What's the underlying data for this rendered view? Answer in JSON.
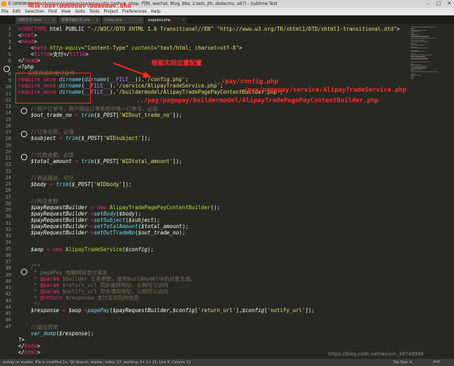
{
  "window": {
    "title": "E:\\WWW\\item\\jxshop\\pay\\pagepay\\pagepay.php (jxshop, shop, 代码, wechat, Blog, bbs, 2.test, jth, dedecms, a67) - Sublime Text",
    "minimize": "–",
    "maximize": "□",
    "close": "✕"
  },
  "menu": [
    "File",
    "Edit",
    "Selection",
    "Find",
    "View",
    "Goto",
    "Tools",
    "Project",
    "Preferences",
    "Help"
  ],
  "tabs": [
    {
      "label": "扫码支付.html",
      "active": false
    },
    {
      "label": "登录页面分享.php",
      "active": false
    },
    {
      "label": "index.php",
      "active": false
    },
    {
      "label": "pagepay.php",
      "active": true
    }
  ],
  "code_lines": [
    {
      "n": "1"
    },
    {
      "n": "2"
    },
    {
      "n": "3"
    },
    {
      "n": "4"
    },
    {
      "n": "5"
    },
    {
      "n": "6"
    },
    {
      "n": "7"
    },
    {
      "n": "8"
    },
    {
      "n": "9"
    },
    {
      "n": "10"
    },
    {
      "n": "11"
    },
    {
      "n": "12"
    },
    {
      "n": "13"
    },
    {
      "n": "14"
    },
    {
      "n": "15"
    },
    {
      "n": "16"
    },
    {
      "n": "17"
    },
    {
      "n": "18"
    },
    {
      "n": "19"
    },
    {
      "n": "20"
    },
    {
      "n": "21"
    },
    {
      "n": "22"
    },
    {
      "n": "23"
    },
    {
      "n": "24"
    },
    {
      "n": "25"
    },
    {
      "n": "26"
    },
    {
      "n": "27"
    },
    {
      "n": "28"
    },
    {
      "n": "29"
    },
    {
      "n": "30"
    },
    {
      "n": "31"
    },
    {
      "n": "32"
    },
    {
      "n": "33"
    },
    {
      "n": "34"
    },
    {
      "n": "35"
    },
    {
      "n": "36"
    },
    {
      "n": "37"
    },
    {
      "n": "38"
    },
    {
      "n": "39"
    },
    {
      "n": "40"
    },
    {
      "n": "41"
    },
    {
      "n": "42"
    },
    {
      "n": "43"
    },
    {
      "n": "44"
    },
    {
      "n": "45"
    },
    {
      "n": "46"
    },
    {
      "n": "47"
    }
  ],
  "code": {
    "l1": {
      "a": "<!DOCTYPE",
      "b": " html PUBLIC ",
      "c": "\"-//W3C//DTD XHTML 1.0 Transitional//EN\"",
      "d": " ",
      "e": "\"http://www.w3.org/TR/xhtml1/DTD/xhtml1-transitional.dtd\"",
      "f": ">"
    },
    "l2": {
      "a": "<",
      "b": "html",
      "c": ">"
    },
    "l3": {
      "a": "<",
      "b": "head",
      "c": ">"
    },
    "l4": {
      "a": "    <",
      "b": "meta",
      "c": " http-equiv",
      "d": "=",
      "e": "\"Content-Type\"",
      "f": " content",
      "g": "=",
      "h": "\"text/html; charset=utf-8\"",
      "i": ">"
    },
    "l5": {
      "a": "    <",
      "b": "title",
      "c": ">支付</",
      "d": "title",
      "e": ">"
    },
    "l6": {
      "a": "</",
      "b": "head",
      "c": ">"
    },
    "l7": {
      "a": "<?php"
    },
    "l8": {
      "a": "// 实现具体的支付操作"
    },
    "l9": {
      "a": "require_once",
      "b": " ",
      "c": "dirname",
      "d": "(",
      "e": "dirname",
      "f": "(",
      "g": "__FILE__",
      "h": ")).",
      "i": "'/config.php'",
      "j": ";"
    },
    "l10": {
      "a": "require_once",
      "b": " ",
      "c": "dirname",
      "d": "(",
      "e": "__FILE__",
      "f": ").",
      "g": "'/service/AlipayTradeService.php'",
      "h": ";"
    },
    "l11": {
      "a": "require_once",
      "b": " ",
      "c": "dirname",
      "d": "(",
      "e": "__FILE__",
      "f": ").",
      "g": "'/buildermodel/AlipayTradePagePayContentBuilder.php'",
      "h": ";"
    },
    "l13": {
      "a": "    //商户订单号，商户网站订单系统中唯一订单号，必填"
    },
    "l14": {
      "a": "    ",
      "b": "$out_trade_no",
      "c": " = ",
      "d": "trim",
      "e": "(",
      "f": "$_POST",
      "g": "[",
      "h": "'WIDout_trade_no'",
      "i": "]);"
    },
    "l16": {
      "a": "    //订单名称，必填"
    },
    "l17": {
      "a": "    ",
      "b": "$subject",
      "c": " = ",
      "d": "trim",
      "e": "(",
      "f": "$_POST",
      "g": "[",
      "h": "'WIDsubject'",
      "i": "]);"
    },
    "l19": {
      "a": "    //付款金额，必填"
    },
    "l20": {
      "a": "    ",
      "b": "$total_amount",
      "c": " = ",
      "d": "trim",
      "e": "(",
      "f": "$_POST",
      "g": "[",
      "h": "'WIDtotal_amount'",
      "i": "]);"
    },
    "l22": {
      "a": "    //商品描述，可空"
    },
    "l23": {
      "a": "    ",
      "b": "$body",
      "c": " = ",
      "d": "trim",
      "e": "(",
      "f": "$_POST",
      "g": "[",
      "h": "'WIDbody'",
      "i": "]);"
    },
    "l25": {
      "a": "    //构造参数"
    },
    "l26": {
      "a": "    ",
      "b": "$payRequestBuilder",
      "c": " = ",
      "d": "new",
      "e": " ",
      "f": "AlipayTradePagePayContentBuilder",
      "g": "();"
    },
    "l27": {
      "a": "    ",
      "b": "$payRequestBuilder",
      "c": "->",
      "d": "setBody",
      "e": "(",
      "f": "$body",
      "g": ");"
    },
    "l28": {
      "a": "    ",
      "b": "$payRequestBuilder",
      "c": "->",
      "d": "setSubject",
      "e": "(",
      "f": "$subject",
      "g": ");"
    },
    "l29": {
      "a": "    ",
      "b": "$payRequestBuilder",
      "c": "->",
      "d": "setTotalAmount",
      "e": "(",
      "f": "$total_amount",
      "g": ");"
    },
    "l30": {
      "a": "    ",
      "b": "$payRequestBuilder",
      "c": "->",
      "d": "setOutTradeNo",
      "e": "(",
      "f": "$out_trade_no",
      "g": ");"
    },
    "l32": {
      "a": "    ",
      "b": "$aop",
      "c": " = ",
      "d": "new",
      "e": " ",
      "f": "AlipayTradeService",
      "g": "(",
      "h": "$config",
      "i": ");"
    },
    "l34": {
      "a": "    /**"
    },
    "l35": {
      "a": "     * pagePay 电脑网站支付请求"
    },
    "l36": {
      "a": "     * ",
      "b": "@param",
      "c": " $builder 业务参数，使用buildmodel中的对象生成。"
    },
    "l37": {
      "a": "     * ",
      "b": "@param",
      "c": " $return_url 同步跳转地址，公网可以访问"
    },
    "l38": {
      "a": "     * ",
      "b": "@param",
      "c": " $notify_url 异步通知地址，公网可以访问"
    },
    "l39": {
      "a": "     * ",
      "b": "@return",
      "c": " $response 支付宝返回的信息"
    },
    "l40": {
      "a": "     */"
    },
    "l41": {
      "a": "    ",
      "b": "$response",
      "c": " = ",
      "d": "$aop",
      "e": "->",
      "f": "pagePay",
      "g": "(",
      "h": "$payRequestBuilder",
      "i": ",",
      "j": "$config",
      "k": "[",
      "l": "'return_url'",
      "m": "],",
      "n": "$config",
      "o": "[",
      "p": "'notify_url'",
      "q": "]);"
    },
    "l43": {
      "a": "    //输出表单"
    },
    "l44": {
      "a": "    ",
      "b": "var_dump",
      "c": "(",
      "d": "$response",
      "e": ");"
    },
    "l45": {
      "a": "?>"
    },
    "l46": {
      "a": "</",
      "b": "body",
      "c": ">"
    },
    "l47": {
      "a": "</",
      "b": "html",
      "c": ">"
    }
  },
  "annotations": {
    "title_path": "项目\\pay\\pagepay\\pagepay.php",
    "actual_location": "根据实际位置配置",
    "path_config": "../pay/config.php",
    "path_service": "../pay/pagepay/service/AlipayTradeService.php",
    "path_builder": "../pay/pagepay/buildermodel/AlipayTradePagePayContentBuilder.php"
  },
  "watermark": "https://blog.csdn.net/weixin_39749988",
  "status": {
    "left": "jxshop on master, File is modified 1+, Git branch: master, index: 27, working: 3+ 1+ 21; Line 8, Column 13",
    "tab_size": "Tab Size: 4",
    "syntax": "PHP"
  },
  "colors": {
    "annotation_red": "#ff2a2a",
    "editor_bg": "#272822"
  }
}
